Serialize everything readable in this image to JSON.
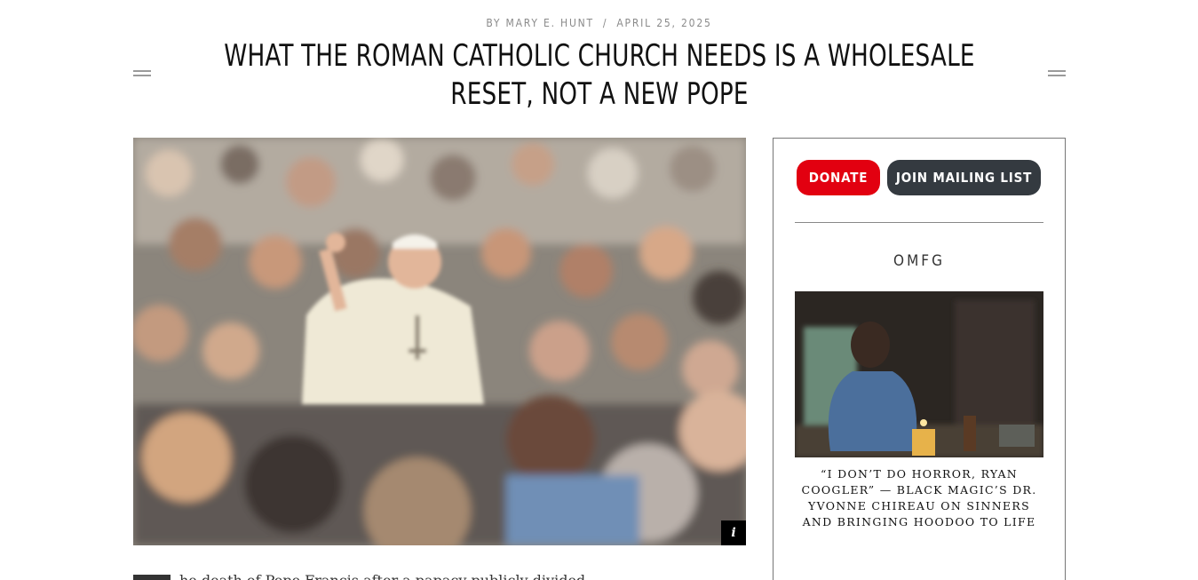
{
  "article": {
    "byline_author": "BY MARY E. HUNT",
    "byline_separator": "/",
    "byline_date": "APRIL 25, 2025",
    "title": "WHAT THE ROMAN CATHOLIC CHURCH NEEDS IS A WHOLESALE RESET, NOT A NEW POPE",
    "hero_info_label": "i",
    "body_start": "he death of Pope Francis after a papacy publicly divided ..."
  },
  "sidebar": {
    "donate_label": "DONATE",
    "join_label": "JOIN MAILING LIST",
    "section_title": "OMFG",
    "feature_caption": "“I DON’T DO HORROR, RYAN COOGLER” — BLACK MAGIC’S DR. YVONNE CHIREAU ON SINNERS AND BRINGING HOODOO TO LIFE"
  },
  "colors": {
    "donate": "#e20010",
    "join": "#343a40",
    "byline": "#8a8a8a"
  }
}
